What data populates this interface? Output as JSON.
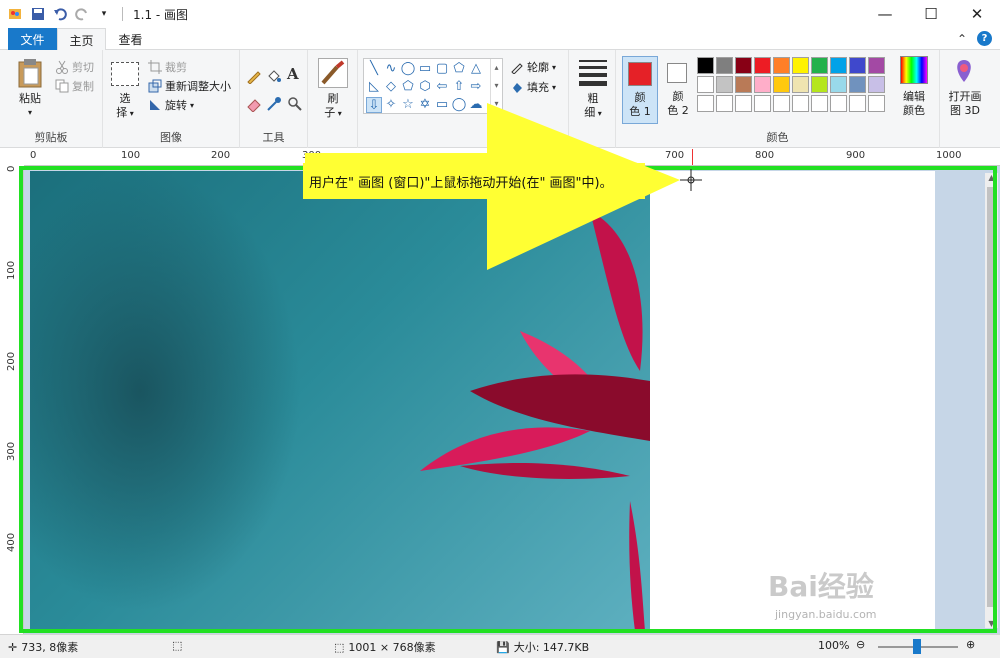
{
  "title_bar": {
    "title": "1.1 - 画图",
    "minimize": "—",
    "maximize": "☐",
    "close": "✕"
  },
  "tabs": {
    "file": "文件",
    "home": "主页",
    "view": "查看"
  },
  "ribbon": {
    "clipboard": {
      "paste": "粘贴",
      "cut": "剪切",
      "copy": "复制",
      "group_label": "剪贴板"
    },
    "image": {
      "select_1": "选",
      "select_2": "择",
      "crop": "裁剪",
      "resize": "重新调整大小",
      "rotate": "旋转",
      "group_label": "图像"
    },
    "tools": {
      "group_label": "工具",
      "text": "A"
    },
    "brushes": {
      "label_1": "刷",
      "label_2": "子"
    },
    "shapes": {
      "outline": "轮廓",
      "fill": "填充"
    },
    "size": {
      "label_1": "粗",
      "label_2": "细"
    },
    "colors": {
      "color1_1": "颜",
      "color1_2": "色 1",
      "color2_1": "颜",
      "color2_2": "色 2",
      "edit_1": "编辑",
      "edit_2": "颜色",
      "group_label": "颜色",
      "color1_value": "#e52127",
      "swatches_row1": [
        "#000000",
        "#7f7f7f",
        "#880015",
        "#ed1c24",
        "#ff7f27",
        "#fff200",
        "#22b14c",
        "#00a2e8",
        "#3f48cc",
        "#a349a4"
      ],
      "swatches_row2": [
        "#ffffff",
        "#c3c3c3",
        "#b97a57",
        "#ffaec9",
        "#ffc90e",
        "#efe4b0",
        "#b5e61d",
        "#99d9ea",
        "#7092be",
        "#c8bfe7"
      ],
      "swatches_row3": [
        "#ffffff",
        "#ffffff",
        "#ffffff",
        "#ffffff",
        "#ffffff",
        "#ffffff",
        "#ffffff",
        "#ffffff",
        "#ffffff",
        "#ffffff"
      ]
    },
    "paint3d": {
      "label_1": "打开画",
      "label_2": "图 3D"
    }
  },
  "ruler_h": [
    "0",
    "100",
    "200",
    "300",
    "700",
    "800",
    "900",
    "1000"
  ],
  "ruler_v": [
    "0",
    "100",
    "200",
    "300",
    "400"
  ],
  "callout": {
    "text": "用户在\" 画图 (窗口)\"上鼠标拖动开始(在\" 画图\"中)。"
  },
  "status": {
    "cursor_pos": "733, 8像素",
    "image_size": "1001 × 768像素",
    "file_size": "大小: 147.7KB",
    "zoom": "100%"
  },
  "watermark": {
    "brand": "Bai经验",
    "url": "jingyan.baidu.com"
  }
}
